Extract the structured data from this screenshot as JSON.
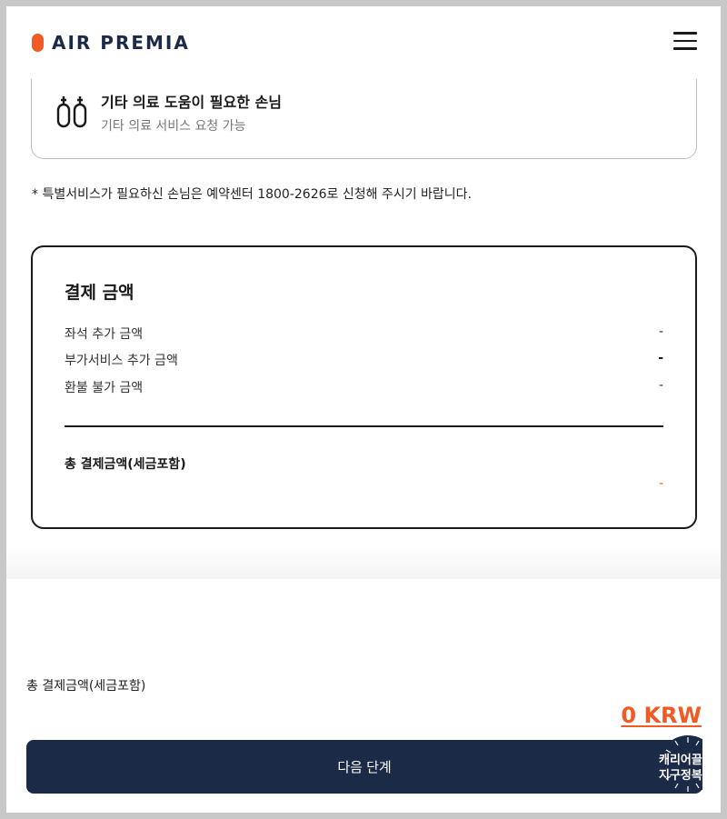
{
  "header": {
    "logo_text": "AIR PREMIA",
    "menu_icon": "hamburger-menu-icon"
  },
  "service_card": {
    "icon": "oxygen-tanks-icon",
    "title": "기타 의료 도움이 필요한 손님",
    "subtitle": "기타 의료 서비스 요청 가능"
  },
  "notice": "* 특별서비스가 필요하신 손님은 예약센터 1800-2626로 신청해 주시기 바랍니다.",
  "payment": {
    "title": "결제 금액",
    "rows": [
      {
        "label": "좌석 추가 금액",
        "value": "-"
      },
      {
        "label": "부가서비스 추가 금액",
        "value": "-"
      },
      {
        "label": "환불 불가 금액",
        "value": "-"
      }
    ],
    "total_label": "총 결제금액(세금포함)",
    "total_value": "-"
  },
  "bottom": {
    "total_label": "총 결제금액(세금포함)",
    "total_amount": "0 KRW",
    "next_button": "다음 단계",
    "badge_line1": "캐리어끌",
    "badge_line2": "지구정복"
  },
  "colors": {
    "brand_orange": "#f15a22",
    "navy": "#1b2a47",
    "text_dark": "#1a1a1a"
  }
}
